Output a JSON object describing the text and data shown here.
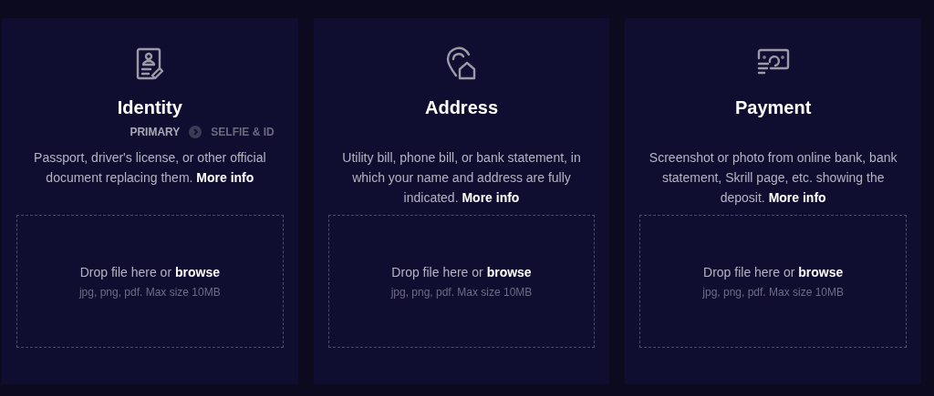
{
  "cards": [
    {
      "title": "Identity",
      "steps": [
        {
          "label": "PRIMARY",
          "selected": true
        },
        {
          "label": "SELFIE & ID",
          "selected": false
        }
      ],
      "description": "Passport, driver's license, or other official document replacing them.",
      "more_link": "More info",
      "drop_text": "Drop file here or",
      "browse_link": "browse",
      "hint": "jpg, png, pdf. Max size 10MB"
    },
    {
      "title": "Address",
      "description": "Utility bill, phone bill, or bank statement, in which your name and address are fully indicated.",
      "more_link": "More info",
      "drop_text": "Drop file here or",
      "browse_link": "browse",
      "hint": "jpg, png, pdf. Max size 10MB"
    },
    {
      "title": "Payment",
      "description": "Screenshot or photo from online bank, bank statement, Skrill page, etc. showing the deposit.",
      "more_link": "More info",
      "drop_text": "Drop file here or",
      "browse_link": "browse",
      "hint": "jpg, png, pdf. Max size 10MB"
    }
  ]
}
